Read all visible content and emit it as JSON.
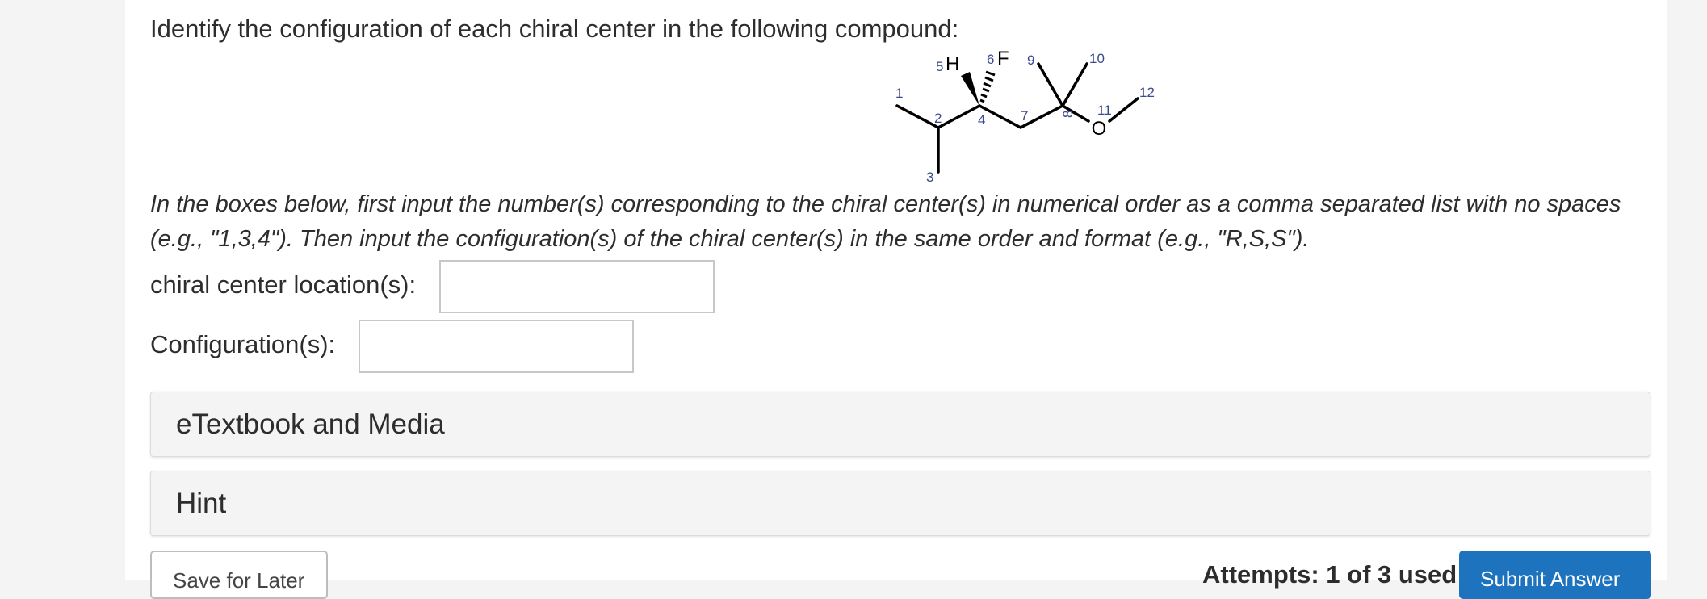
{
  "question": {
    "prompt": "Identify the configuration of each chiral center in the following compound:",
    "instructions": "In the boxes below, first input the number(s) corresponding to the chiral center(s) in numerical order as a comma separated list with no spaces (e.g., \"1,3,4\"). Then input the configuration(s) of the chiral center(s) in the same order and format (e.g., \"R,S,S\")."
  },
  "molecule": {
    "atom_labels": {
      "h": "H",
      "f": "F",
      "o": "O"
    },
    "position_numbers": [
      "1",
      "2",
      "3",
      "4",
      "5",
      "6",
      "7",
      "8",
      "9",
      "10",
      "11",
      "12"
    ]
  },
  "fields": {
    "location_label": "chiral center location(s):",
    "location_value": "",
    "configuration_label": "Configuration(s):",
    "configuration_value": ""
  },
  "panels": {
    "etextbook": "eTextbook and Media",
    "hint": "Hint"
  },
  "footer": {
    "save_label": "Save for Later",
    "attempts": "Attempts: 1 of 3 used",
    "submit_label": "Submit Answer"
  },
  "colors": {
    "submit_background": "#1e73be",
    "panel_background": "#f4f4f4"
  }
}
